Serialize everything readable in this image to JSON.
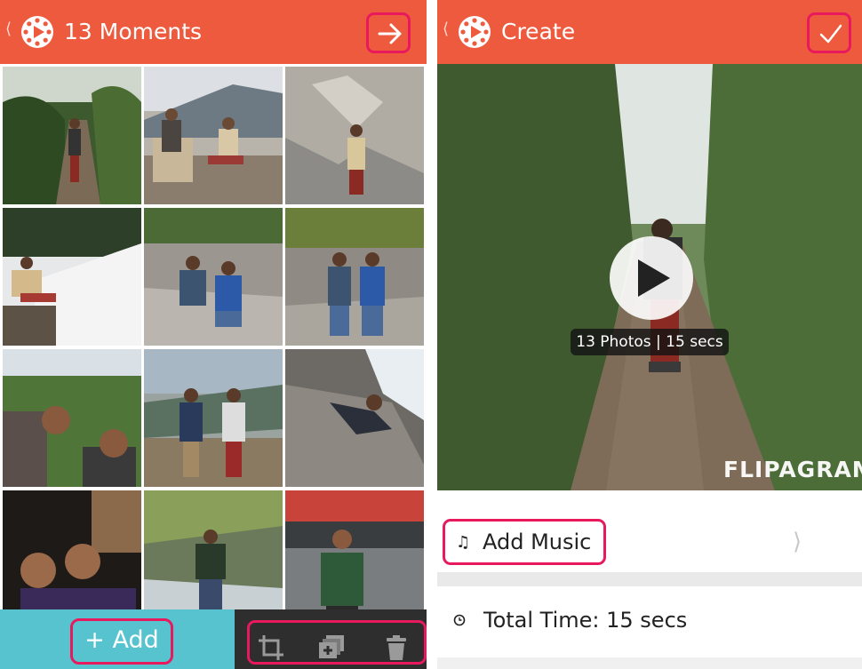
{
  "left_screen": {
    "title": "13 Moments",
    "actions": {
      "next_icon": "arrow-right-icon"
    },
    "photos": [
      "trail-hiker",
      "men-on-chairs",
      "man-by-rock",
      "man-in-snow",
      "men-on-rocks",
      "men-standing-valley",
      "selfie-men",
      "men-mountain-view",
      "man-on-boulder",
      "night-selfie",
      "man-at-riverbank",
      "man-at-market"
    ],
    "bottom": {
      "add_label": "+ Add",
      "tools": [
        "crop-icon",
        "duplicate-icon",
        "trash-icon"
      ]
    }
  },
  "right_screen": {
    "title": "Create",
    "actions": {
      "confirm_icon": "checkmark-icon"
    },
    "preview": {
      "info": "13 Photos | 15 secs",
      "watermark": "FLIPAGRAM"
    },
    "music": {
      "icon": "music-note-icon",
      "label": "Add Music"
    },
    "total_time": {
      "icon": "clock-icon",
      "label": "Total Time: 15 secs"
    }
  },
  "colors": {
    "appbar": "#ee5a3d",
    "highlight": "#e8195d",
    "add_bar": "#56c3ce",
    "tools_bar": "#2e2e2e"
  }
}
